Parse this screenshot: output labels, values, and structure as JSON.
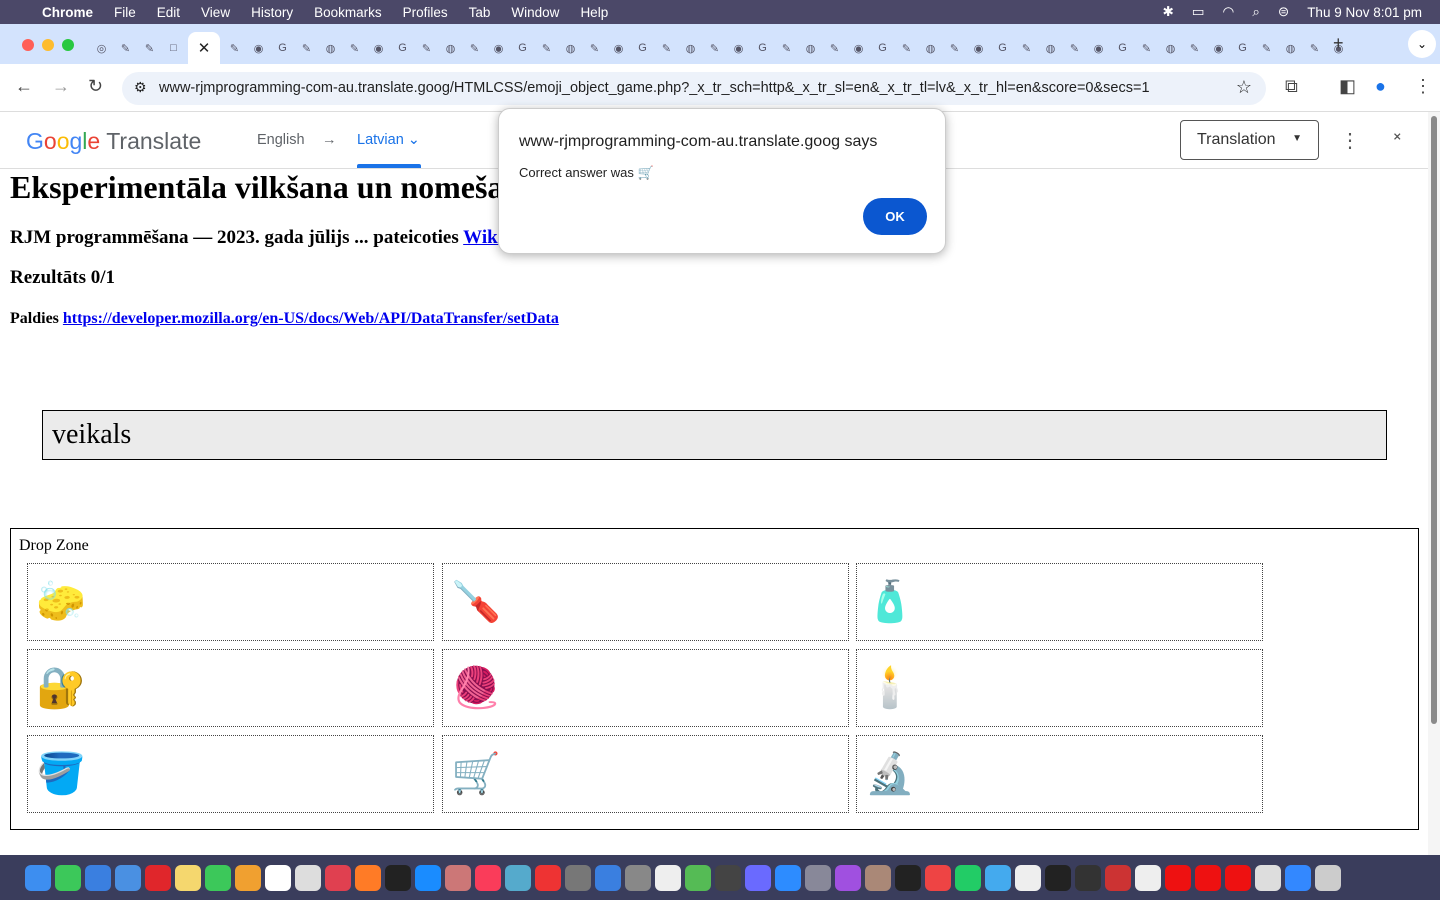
{
  "menubar": {
    "apple": "",
    "app": "Chrome",
    "items": [
      "File",
      "Edit",
      "View",
      "History",
      "Bookmarks",
      "Profiles",
      "Tab",
      "Window",
      "Help"
    ],
    "datetime": "Thu 9 Nov  8:01 pm"
  },
  "tabs": {
    "count_icons": 52,
    "active_close": "✕",
    "new_tab": "+"
  },
  "toolbar": {
    "url": "www-rjmprogramming-com-au.translate.goog/HTMLCSS/emoji_object_game.php?_x_tr_sch=http&_x_tr_sl=en&_x_tr_tl=lv&_x_tr_hl=en&score=0&secs=1"
  },
  "translate_bar": {
    "logo": "Google Translate",
    "source": "English",
    "arrow": "→",
    "target": "Latvian",
    "mode": "Translation"
  },
  "page": {
    "title": "Eksperimentāla vilkšana un nomešana",
    "subtitle": "RJM programmēšana — 2023. gada jūlijs ... pateicoties ",
    "subtitle_link": "Wikipedia",
    "score": "Rezultāts 0/1",
    "thanks": "Paldies ",
    "thanks_link": "https://developer.mozilla.org/en-US/docs/Web/API/DataTransfer/setData",
    "word": "veikals",
    "dropzone_label": "Drop Zone",
    "cells": [
      "🧽",
      "🪛",
      "🧴",
      "🔐",
      "🧶",
      "🕯️",
      "🪣",
      "🛒",
      "🔬"
    ]
  },
  "dialog": {
    "title": "www-rjmprogramming-com-au.translate.goog says",
    "message": "Correct answer was 🛒",
    "ok": "OK"
  },
  "colors": {
    "accent": "#0b57d0",
    "tabstrip": "#d3e3fd",
    "link": "#0000ee"
  }
}
